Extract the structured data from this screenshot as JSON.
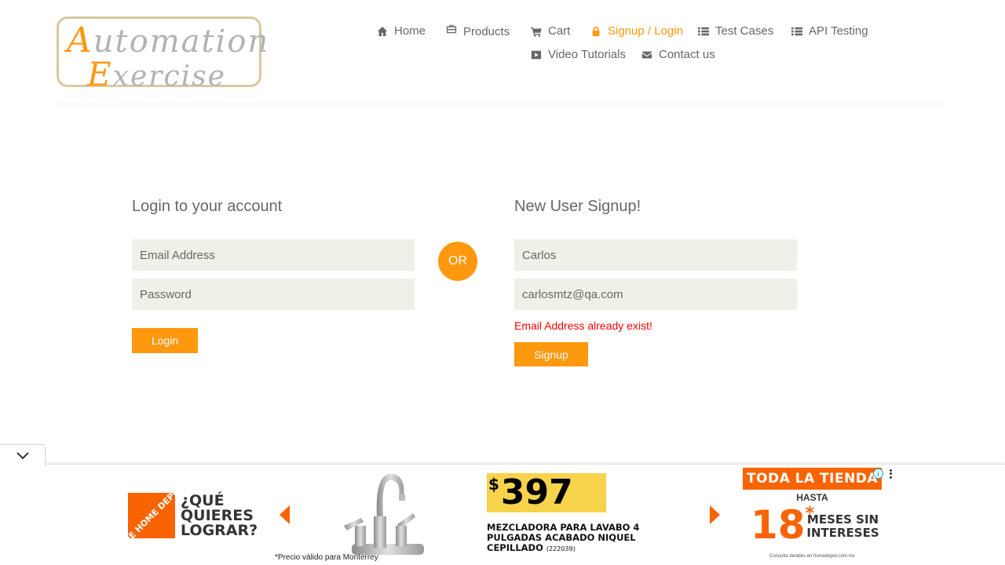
{
  "logo": {
    "line1_cap": "A",
    "line1_rest": "utomation",
    "line2_cap": "E",
    "line2_rest": "xercise"
  },
  "nav": {
    "items": [
      {
        "label": "Home",
        "icon": "home-icon"
      },
      {
        "label": "Products",
        "icon": "products-icon"
      },
      {
        "label": "Cart",
        "icon": "cart-icon"
      },
      {
        "label": "Signup / Login",
        "icon": "lock-icon",
        "active": true
      },
      {
        "label": "Test Cases",
        "icon": "list-icon"
      },
      {
        "label": "API Testing",
        "icon": "list-icon"
      },
      {
        "label": "Video Tutorials",
        "icon": "video-icon"
      },
      {
        "label": "Contact us",
        "icon": "envelope-icon"
      }
    ]
  },
  "login": {
    "title": "Login to your account",
    "email_placeholder": "Email Address",
    "password_placeholder": "Password",
    "button": "Login"
  },
  "or_label": "OR",
  "signup": {
    "title": "New User Signup!",
    "name_value": "Carlos",
    "email_value": "carlosmtz@qa.com",
    "error": "Email Address already exist!",
    "button": "Signup"
  },
  "ad": {
    "brand_logo_text": "THE HOME DEPOT",
    "slogan": "¿QUÉ QUIERES LOGRAR?",
    "note": "*Precio válido para Monterrey",
    "currency": "$",
    "price": "397",
    "product": "MEZCLADORA PARA LAVABO 4 PULGADAS ACABADO NIQUEL CEPILLADO",
    "sku": "(222039)",
    "promo_top": "TODA LA TIENDA",
    "promo_hasta": "HASTA",
    "promo_big": "18",
    "promo_star": "*",
    "promo_small": "MESES SIN INTERESES",
    "promo_fine": "Consulta detalles en homedepot.com.mx",
    "info_label": "i"
  },
  "colors": {
    "accent": "#fe980f",
    "input_bg": "#f0f0e9",
    "error": "#ff0000",
    "text": "#696763",
    "ad_orange": "#f96302"
  }
}
